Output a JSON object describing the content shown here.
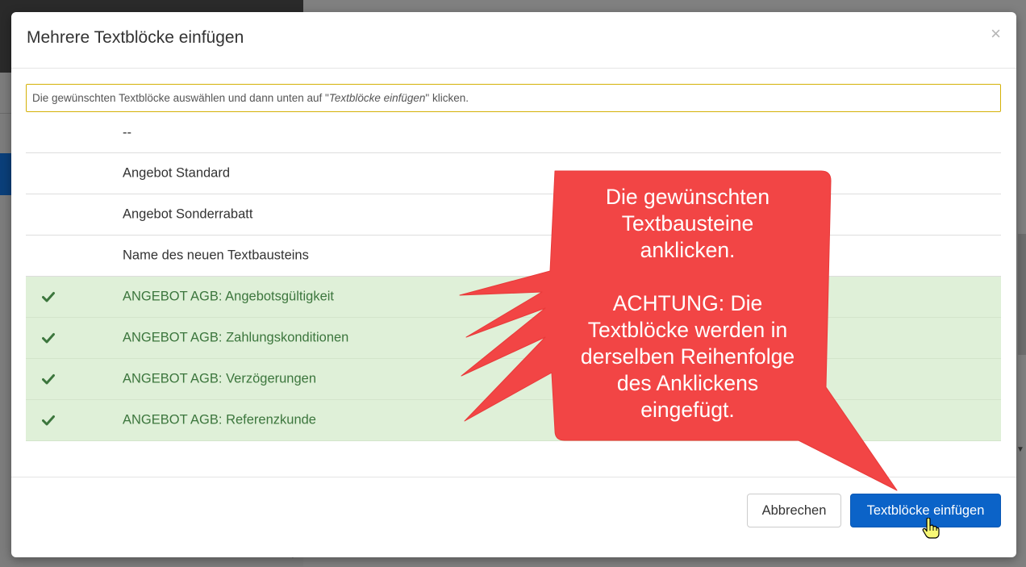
{
  "modal": {
    "title": "Mehrere Textblöcke einfügen",
    "close_label": "×",
    "hint_prefix": "Die gewünschten Textblöcke auswählen und dann unten auf \"",
    "hint_em": "Textblöcke einfügen",
    "hint_suffix": "\" klicken."
  },
  "items": [
    {
      "label": "--",
      "selected": false
    },
    {
      "label": "Angebot Standard",
      "selected": false
    },
    {
      "label": "Angebot Sonderrabatt",
      "selected": false
    },
    {
      "label": "Name des neuen Textbausteins",
      "selected": false
    },
    {
      "label": "ANGEBOT AGB: Angebotsgültigkeit",
      "selected": true
    },
    {
      "label": "ANGEBOT AGB: Zahlungskonditionen",
      "selected": true
    },
    {
      "label": "ANGEBOT AGB: Verzögerungen",
      "selected": true
    },
    {
      "label": "ANGEBOT AGB: Referenzkunde",
      "selected": true
    }
  ],
  "footer": {
    "cancel_label": "Abbrechen",
    "insert_label": "Textblöcke einfügen"
  },
  "callout": {
    "lines": [
      "Die gewünschten",
      "Textbausteine",
      "anklicken.",
      "",
      "ACHTUNG: Die",
      "Textblöcke werden in",
      "derselben Reihenfolge",
      "des Anklickens",
      "eingefügt."
    ],
    "color": "#f24545"
  },
  "colors": {
    "selected_bg": "#dff0d8",
    "selected_text": "#3c763d",
    "primary": "#0b63c8",
    "hint_border": "#d4b106"
  },
  "icons": {
    "check": "check-icon",
    "close": "close-icon",
    "cursor": "hand-pointer-icon"
  }
}
